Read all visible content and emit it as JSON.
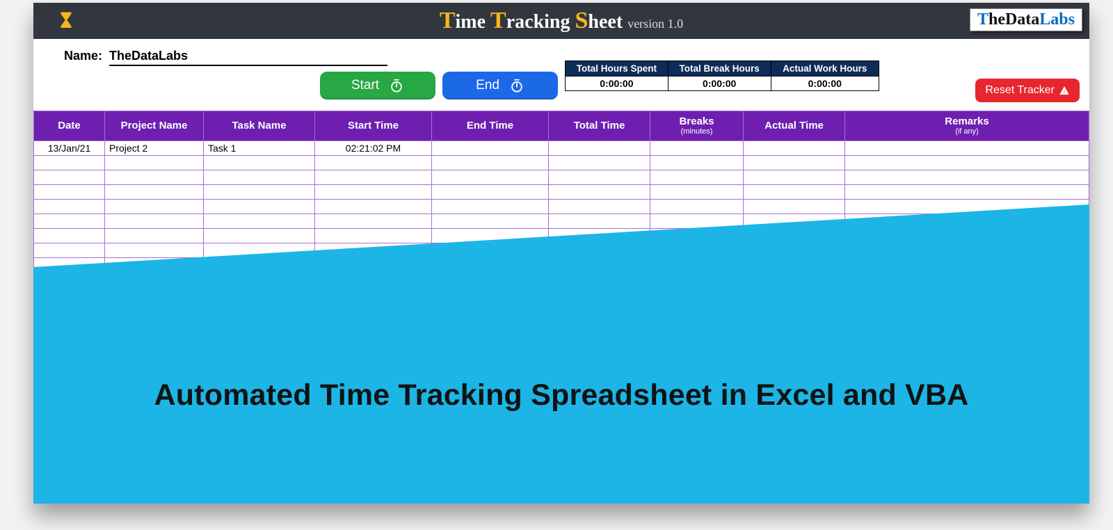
{
  "header": {
    "title_prefix_big": "T",
    "title_word1": "ime ",
    "title_big2": "T",
    "title_word2": "racking ",
    "title_big3": "S",
    "title_word3": "heet ",
    "version": "version 1.0",
    "logo_t1": "T",
    "logo_t2": "heData",
    "logo_t3": "Labs"
  },
  "name": {
    "label": "Name:",
    "value": "TheDataLabs"
  },
  "buttons": {
    "start": "Start",
    "end": "End",
    "reset": "Reset Tracker"
  },
  "summary": {
    "headers": [
      "Total Hours Spent",
      "Total Break Hours",
      "Actual Work Hours"
    ],
    "values": [
      "0:00:00",
      "0:00:00",
      "0:00:00"
    ]
  },
  "columns": {
    "date": "Date",
    "project": "Project Name",
    "task": "Task Name",
    "start": "Start Time",
    "end": "End Time",
    "total": "Total Time",
    "breaks": "Breaks",
    "breaks_sub": "(minutes)",
    "actual": "Actual Time",
    "remarks": "Remarks",
    "remarks_sub": "(if any)"
  },
  "rows": [
    {
      "date": "13/Jan/21",
      "project": "Project 2",
      "task": "Task 1",
      "start": "02:21:02 PM",
      "end": "",
      "total": "",
      "breaks": "",
      "actual": "",
      "remarks": ""
    },
    {},
    {},
    {},
    {},
    {},
    {},
    {},
    {}
  ],
  "overlay": {
    "headline": "Automated Time Tracking Spreadsheet in Excel and VBA"
  }
}
